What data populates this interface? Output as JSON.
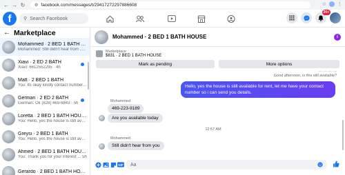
{
  "browser": {
    "url": "facebook.com/messages/t/29417272297886608"
  },
  "topbar": {
    "search_placeholder": "Search Facebook",
    "notif_count": "20+"
  },
  "sidebar": {
    "title": "Marketplace",
    "conversations": [
      {
        "title": "Mohammed · 2 BED 1 BATH HOUSE",
        "snippet": "Mohammed: Still didn't hear from ... 2h",
        "unread": false,
        "active": true
      },
      {
        "title": "Xiavi · 2 ED 2 BATH",
        "snippet": "Xiavi: 6612552295 · 4h",
        "unread": true,
        "active": false
      },
      {
        "title": "Matt · 2 BED 1 BATH",
        "snippet": "You: Its okay kindly contact number... 5h",
        "unread": false,
        "active": false
      },
      {
        "title": "German · 2 ED 2 BATH",
        "snippet": "German: Ok (828) 469-6843 · 5h",
        "unread": true,
        "active": false
      },
      {
        "title": "Loretta · 2 BED 1 BATH HOUSE",
        "snippet": "You: Hello, yes the house is still available... 5h",
        "unread": false,
        "active": false
      },
      {
        "title": "Greysi · 2 BED 1 BATH",
        "snippet": "You: Hello, yes the house is still avai... 5h",
        "unread": false,
        "active": false
      },
      {
        "title": "Ahmed · 2 BED 1 BATH HOUSE",
        "snippet": "You: Thank you for your interest ... 5h",
        "unread": false,
        "active": false
      },
      {
        "title": "Gerardo · 2 BED 1 BATH HOUSE",
        "snippet": "",
        "unread": false,
        "active": false
      }
    ]
  },
  "chat": {
    "title": "Mohammed · 2 BED 1 BATH HOUSE",
    "listing_label": "Marketplace",
    "listing_price": "$831 · 2 BED 1 BATH HOUSE",
    "mark_pending": "Mark as pending",
    "more_options": "More options",
    "seen_text": "Good afternoon, is this still available?",
    "outgoing_message": "Hello, yes the house is still available for rent, let me have your contact number so i can send you details.",
    "sender_name": "Mohammed",
    "msg_phone": "469-223-9189",
    "msg_available": "Are you available today",
    "timestamp": "12:57 AM",
    "msg_still": "Still didn't hear from you",
    "composer_placeholder": "Aa"
  }
}
